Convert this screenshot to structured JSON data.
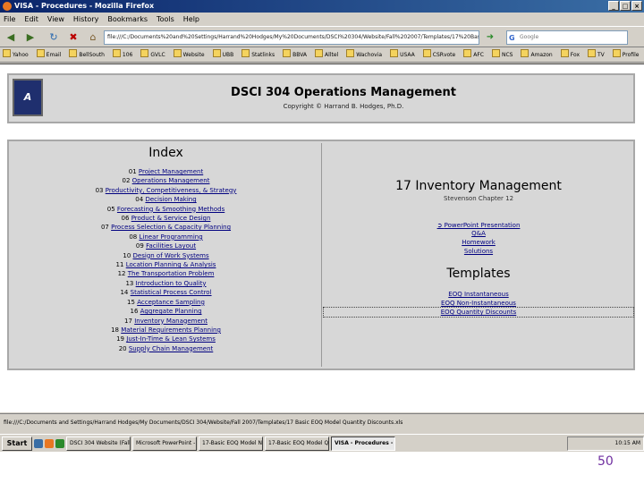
{
  "window": {
    "title": "VISA - Procedures - Mozilla Firefox"
  },
  "menu": [
    "File",
    "Edit",
    "View",
    "History",
    "Bookmarks",
    "Tools",
    "Help"
  ],
  "nav": {
    "url": "file:///C:/Documents%20and%20Settings/Harrand%20Hodges/My%20Documents/DSCI%20304/Website/Fall%202007/Templates/17%20Basic%20EOQ%20Model%20Quantity%20Discounts.xls",
    "search_placeholder": "Google"
  },
  "bookmarks": [
    "Yahoo",
    "Email",
    "BellSouth",
    "106",
    "GVLC",
    "Website",
    "UBB",
    "Statlinks",
    "BBVA",
    "Alltel",
    "Wachovia",
    "USAA",
    "CSRvote",
    "AFC",
    "NCS",
    "Amazon",
    "Fox",
    "TV",
    "Profile"
  ],
  "header": {
    "logo_text": "A",
    "title": "DSCI 304 Operations Management",
    "copyright": "Copyright © Harrand B. Hodges, Ph.D."
  },
  "index": {
    "title": "Index",
    "items": [
      {
        "num": "01",
        "label": "Project Management"
      },
      {
        "num": "02",
        "label": "Operations Management"
      },
      {
        "num": "03",
        "label": "Productivity, Competitiveness, & Strategy"
      },
      {
        "num": "04",
        "label": "Decision Making"
      },
      {
        "num": "05",
        "label": "Forecasting & Smoothing Methods"
      },
      {
        "num": "06",
        "label": "Product & Service Design"
      },
      {
        "num": "07",
        "label": "Process Selection & Capacity Planning"
      },
      {
        "num": "08",
        "label": "Linear Programming"
      },
      {
        "num": "09",
        "label": "Facilities Layout"
      },
      {
        "num": "10",
        "label": "Design of Work Systems"
      },
      {
        "num": "11",
        "label": "Location Planning & Analysis"
      },
      {
        "num": "12",
        "label": "The Transportation Problem"
      },
      {
        "num": "13",
        "label": "Introduction to Quality"
      },
      {
        "num": "14",
        "label": "Statistical Process Control"
      },
      {
        "num": "15",
        "label": "Acceptance Sampling"
      },
      {
        "num": "16",
        "label": "Aggregate Planning"
      },
      {
        "num": "17",
        "label": "Inventory Management"
      },
      {
        "num": "18",
        "label": "Material Requirements Planning"
      },
      {
        "num": "19",
        "label": "Just-In-Time & Lean Systems"
      },
      {
        "num": "20",
        "label": "Supply Chain Management"
      }
    ]
  },
  "chapter": {
    "title": "17 Inventory Management",
    "subtitle": "Stevenson Chapter 12",
    "ppt_label": "PowerPoint Presentation",
    "links": [
      "Q&A",
      "Homework",
      "Solutions"
    ]
  },
  "templates": {
    "title": "Templates",
    "links": [
      "EOQ Instantaneous",
      "EOQ Non-Instantaneous",
      "EOQ Quantity Discounts"
    ]
  },
  "status": {
    "text": "file:///C:/Documents and Settings/Harrand Hodges/My Documents/DSCI 304/Website/Fall 2007/Templates/17 Basic EOQ Model Quantity Discounts.xls"
  },
  "taskbar": {
    "start": "Start",
    "tasks": [
      "DSCI 304 Website (Fall...",
      "Microsoft PowerPoint - [...",
      "17-Basic EOQ Model Nonins...",
      "17-Basic EOQ Model Q...",
      "VISA - Procedures - Mo..."
    ],
    "active_index": 4,
    "clock": "10:15 AM"
  },
  "slide": {
    "page_number": "50"
  }
}
